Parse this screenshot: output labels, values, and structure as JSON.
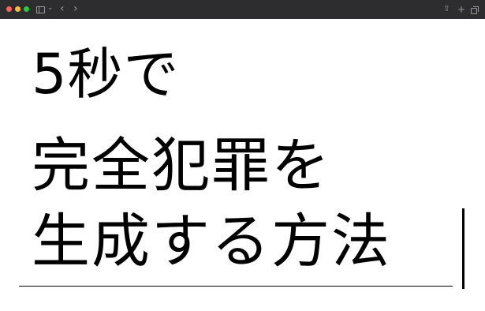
{
  "window": {
    "traffic_lights": {
      "close_color": "#ff5f57",
      "minimize_color": "#febc2e",
      "zoom_color": "#28c840"
    },
    "toolbar": {
      "sidebar_chevron": "⌄",
      "back_glyph": "‹",
      "forward_glyph": "›",
      "share_glyph": "⇧",
      "new_tab_glyph": "+"
    }
  },
  "headline": {
    "line1": "5秒で",
    "line2": "完全犯罪を",
    "line3": "生成する方法"
  }
}
